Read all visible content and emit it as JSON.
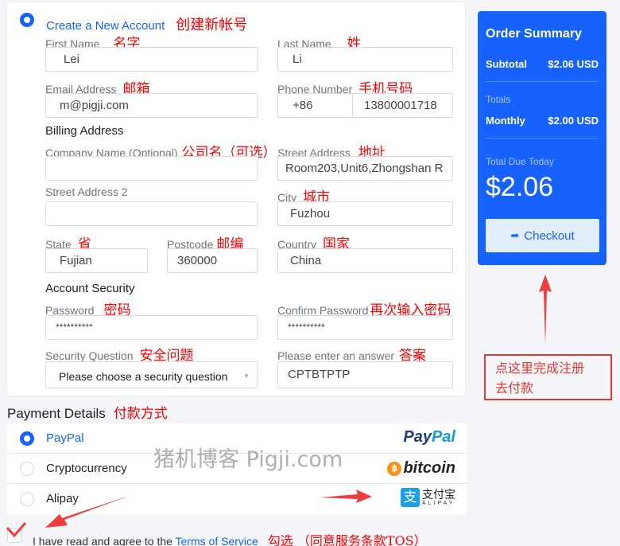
{
  "account": {
    "option_label": "Create a New Account",
    "option_annotation": "创建新帐号",
    "fields": {
      "first_name": {
        "label": "First Name",
        "annotation": "名字",
        "value": "Lei"
      },
      "last_name": {
        "label": "Last Name",
        "annotation": "姓",
        "value": "Li"
      },
      "email": {
        "label": "Email Address",
        "annotation": "邮箱",
        "value": "m@pigji.com"
      },
      "phone": {
        "label": "Phone Number",
        "annotation": "手机号码",
        "country_code": "+86",
        "value": "13800001718"
      }
    }
  },
  "billing": {
    "heading": "Billing Address",
    "fields": {
      "company": {
        "label": "Company Name (Optional)",
        "annotation": "公司名（可选）",
        "value": ""
      },
      "street": {
        "label": "Street Address",
        "annotation": "地址",
        "value": "Room203,Unit6,Zhongshan R"
      },
      "street2": {
        "label": "Street Address 2",
        "annotation": "",
        "value": ""
      },
      "city": {
        "label": "City",
        "annotation": "城市",
        "value": "Fuzhou"
      },
      "state": {
        "label": "State",
        "annotation": "省",
        "value": "Fujian"
      },
      "postcode": {
        "label": "Postcode",
        "annotation": "邮编",
        "value": "360000"
      },
      "country": {
        "label": "Country",
        "annotation": "国家",
        "value": "China"
      }
    }
  },
  "security": {
    "heading": "Account Security",
    "fields": {
      "password": {
        "label": "Password",
        "annotation": "密码",
        "value": "**********"
      },
      "confirm_password": {
        "label": "Confirm Password",
        "annotation": "再次输入密码",
        "value": "**********"
      },
      "question": {
        "label": "Security Question",
        "annotation": "安全问题",
        "value": "Please choose a security question"
      },
      "answer": {
        "label": "Please enter an answer",
        "annotation": "答案",
        "value": "CPTBTPTP"
      }
    }
  },
  "summary": {
    "title": "Order Summary",
    "subtotal_label": "Subtotal",
    "subtotal_value": "$2.06 USD",
    "totals_label": "Totals",
    "monthly_label": "Monthly",
    "monthly_value": "$2.00 USD",
    "due_label": "Total Due Today",
    "due_value": "$2.06",
    "checkout_label": "Checkout",
    "accent_color": "#1761fd"
  },
  "checkout_note": {
    "line1": "点这里完成注册",
    "line2": "去付款"
  },
  "payment": {
    "heading": "Payment Details",
    "annotation": "付款方式",
    "methods": [
      {
        "label": "PayPal",
        "selected": true,
        "logo": "PayPal"
      },
      {
        "label": "Cryptocurrency",
        "selected": false,
        "logo": "bitcoin"
      },
      {
        "label": "Alipay",
        "selected": false,
        "logo": "支付宝",
        "logo_sub": "ALIPAY"
      }
    ]
  },
  "tos": {
    "text": "I have read and agree to the ",
    "link": "Terms of Service",
    "annotation": "勾选 （同意服务条款TOS）",
    "checked": true
  },
  "watermark": "猪机博客 Pigji.com"
}
